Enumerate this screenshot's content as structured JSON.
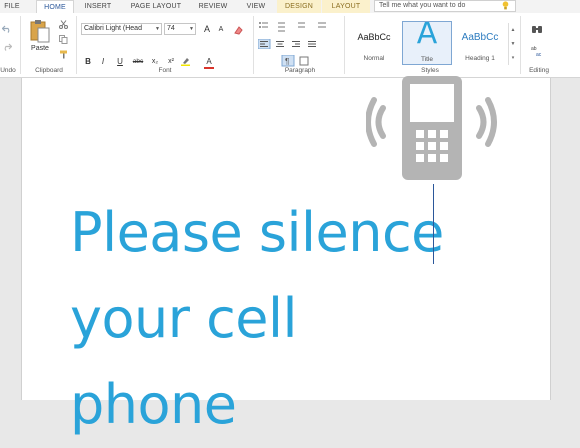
{
  "tabs": [
    {
      "id": "file",
      "label": "FILE"
    },
    {
      "id": "home",
      "label": "HOME"
    },
    {
      "id": "insert",
      "label": "INSERT"
    },
    {
      "id": "page_layout",
      "label": "PAGE LAYOUT"
    },
    {
      "id": "review",
      "label": "REVIEW"
    },
    {
      "id": "view",
      "label": "VIEW"
    },
    {
      "id": "design",
      "label": "DESIGN"
    },
    {
      "id": "layout",
      "label": "LAYOUT"
    }
  ],
  "search": {
    "placeholder": "Tell me what you want to do"
  },
  "ribbon": {
    "undo_group": "Undo",
    "clipboard": {
      "paste_label": "Paste",
      "group": "Clipboard"
    },
    "font": {
      "name": "Calibri Light (Head",
      "size": "74",
      "group": "Font",
      "bold": "B",
      "italic": "I",
      "underline": "U",
      "strike": "abc",
      "subscript": "x₂",
      "superscript": "x²",
      "grow": "A",
      "shrink": "A",
      "color_letter": "A"
    },
    "paragraph": {
      "group": "Paragraph"
    },
    "styles": {
      "group": "Styles",
      "items": [
        {
          "sample": "AaBbCc",
          "name": "Normal"
        },
        {
          "sample": "A",
          "name": "Title"
        },
        {
          "sample": "AaBbCc",
          "name": "Heading 1"
        }
      ]
    },
    "editing": {
      "group": "Editing"
    }
  },
  "document": {
    "lines": [
      "Please silence",
      "your cell",
      "phone"
    ],
    "text_color": "#2aa3d9",
    "graphic_icon": "vibrating-phone-icon"
  },
  "colors": {
    "accent": "#2b579a",
    "ribbon_bg": "#ffffff",
    "tab_bg": "#f3f3f3",
    "context_tab": "#fbf1cc"
  }
}
